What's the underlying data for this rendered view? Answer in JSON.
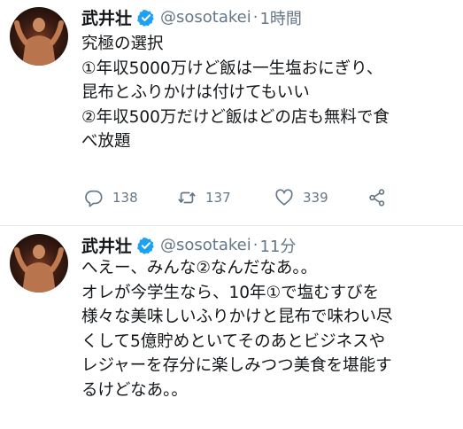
{
  "tweets": [
    {
      "author_name": "武井壮",
      "handle": "@sosotakei",
      "separator": "·",
      "time": "1時間",
      "lines": [
        "究極の選択",
        "①年収5000万けど飯は一生塩おにぎり、",
        "昆布とふりかけは付けてもいい",
        "②年収500万だけど飯はどの店も無料で食",
        "べ放題"
      ],
      "replies": "138",
      "retweets": "137",
      "likes": "339",
      "icons": {
        "reply": "reply-icon",
        "retweet": "retweet-icon",
        "like": "heart-icon",
        "share": "share-icon"
      }
    },
    {
      "author_name": "武井壮",
      "handle": "@sosotakei",
      "separator": "·",
      "time": "11分",
      "lines": [
        "へえー、みんな②なんだなあ。。",
        "オレが今学生なら、10年①で塩むすびを",
        "様々な美味しいふりかけと昆布で味わい尽",
        "くして5億貯めといてそのあとビジネスや",
        "レジャーを存分に楽しみつつ美食を堪能す",
        "るけどなあ。。"
      ]
    }
  ],
  "colors": {
    "text": "#14171a",
    "secondary": "#657786",
    "verified": "#1da1f2",
    "divider": "#e6ecf0"
  }
}
